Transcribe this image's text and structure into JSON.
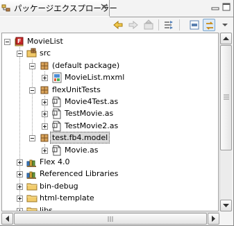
{
  "view": {
    "title": "パッケージエクスプローラー",
    "icons": {
      "view": "package-explorer-icon",
      "close": "close-icon",
      "minimize": "minimize-icon",
      "maximize": "maximize-icon"
    }
  },
  "toolbar": {
    "buttons": [
      {
        "name": "back",
        "icon": "back-arrow-icon"
      },
      {
        "name": "forward",
        "icon": "forward-arrow-icon"
      },
      {
        "name": "up",
        "icon": "up-folder-icon"
      },
      {
        "name": "collapse-all",
        "icon": "collapse-all-icon"
      },
      {
        "name": "focus",
        "icon": "focus-icon"
      },
      {
        "name": "link-with-editor",
        "icon": "link-with-editor-icon",
        "pressed": true
      }
    ]
  },
  "tree": {
    "rows": [
      {
        "label": "MovieList",
        "icon": "flex-project-icon",
        "depth": 0,
        "toggle": "minus"
      },
      {
        "label": "src",
        "icon": "source-folder-icon",
        "depth": 1,
        "toggle": "minus"
      },
      {
        "label": "(default package)",
        "icon": "package-icon",
        "depth": 2,
        "toggle": "minus"
      },
      {
        "label": "MovieList.mxml",
        "icon": "mxml-file-icon",
        "depth": 3,
        "toggle": "plus"
      },
      {
        "label": "flexUnitTests",
        "icon": "package-icon",
        "depth": 2,
        "toggle": "minus"
      },
      {
        "label": "Movie4Test.as",
        "icon": "as-file-icon",
        "depth": 3,
        "toggle": "plus"
      },
      {
        "label": "TestMovie.as",
        "icon": "as-file-icon",
        "depth": 3,
        "toggle": "plus"
      },
      {
        "label": "TestMovie2.as",
        "icon": "as-file-icon",
        "depth": 3,
        "toggle": "plus"
      },
      {
        "label": "test.fb4.model",
        "icon": "package-icon",
        "depth": 2,
        "toggle": "minus",
        "selected": true
      },
      {
        "label": "Movie.as",
        "icon": "as-file-icon",
        "depth": 3,
        "toggle": "plus"
      },
      {
        "label": "Flex 4.0",
        "icon": "library-icon",
        "depth": 1,
        "toggle": "plus"
      },
      {
        "label": "Referenced Libraries",
        "icon": "library-icon",
        "depth": 1,
        "toggle": "plus"
      },
      {
        "label": "bin-debug",
        "icon": "folder-icon",
        "depth": 1,
        "toggle": "plus"
      },
      {
        "label": "html-template",
        "icon": "folder-icon",
        "depth": 1,
        "toggle": "plus"
      },
      {
        "label": "libs",
        "icon": "folder-icon",
        "depth": 1,
        "toggle": "plus"
      }
    ]
  },
  "scrollbars": {
    "vertical": {
      "position": 0.0,
      "visible_fraction": 0.72
    },
    "horizontal": {
      "position": 0.0,
      "visible_fraction": 0.95
    }
  }
}
